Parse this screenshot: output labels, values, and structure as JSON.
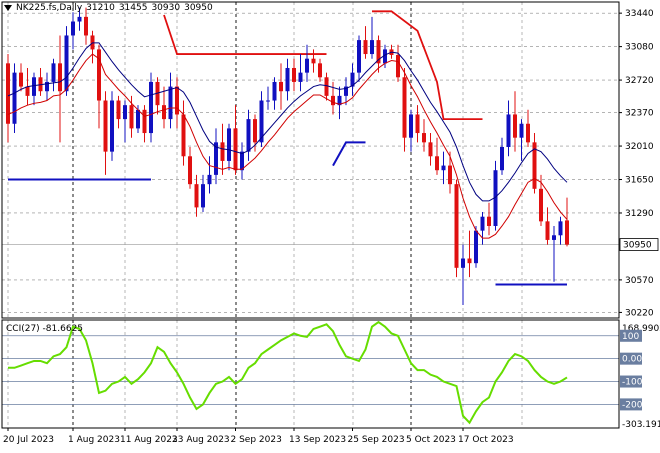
{
  "title": {
    "symbol": "NK225.fs,Daily",
    "ohlc": [
      "31210",
      "31455",
      "30930",
      "30950"
    ]
  },
  "price_axis": {
    "labels": [
      "33440",
      "33080",
      "32720",
      "32370",
      "32010",
      "31650",
      "31290",
      "30950",
      "30570",
      "30220"
    ],
    "current_price": "30950"
  },
  "cci": {
    "label": "CCI(27) -81.6625",
    "axis_labels": [
      "168.9902",
      "100",
      "0.00",
      "-100",
      "-200",
      "-303.191"
    ]
  },
  "time_axis": {
    "labels": [
      "20 Jul 2023",
      "1 Aug 2023",
      "11 Aug 2023",
      "23 Aug 2023",
      "2 Sep 2023",
      "13 Sep 2023",
      "25 Sep 2023",
      "5 Oct 2023",
      "17 Oct 2023"
    ]
  },
  "colors": {
    "bull": "#1010c0",
    "bear": "#e01010",
    "fast_ma": "#d00000",
    "slow_ma": "#000080",
    "cci_line": "#66dd00",
    "cci_level": "#6a7ea0",
    "grid": "#888888"
  },
  "chart_data": {
    "type": "candlestick",
    "price_range": [
      30160,
      33560
    ],
    "cci_range": [
      -303.191,
      168.9902
    ],
    "candles": [
      [
        32900,
        33000,
        32050,
        32250
      ],
      [
        32250,
        32900,
        32150,
        32800
      ],
      [
        32800,
        32900,
        32600,
        32650
      ],
      [
        32650,
        32850,
        32450,
        32550
      ],
      [
        32550,
        32800,
        32450,
        32750
      ],
      [
        32750,
        32850,
        32550,
        32600
      ],
      [
        32600,
        32800,
        32500,
        32700
      ],
      [
        32700,
        32950,
        32600,
        32900
      ],
      [
        32900,
        33200,
        32050,
        32600
      ],
      [
        32600,
        33300,
        32550,
        33200
      ],
      [
        33200,
        33450,
        33050,
        33350
      ],
      [
        33350,
        33500,
        33250,
        33400
      ],
      [
        33400,
        33500,
        33100,
        33200
      ],
      [
        33200,
        33250,
        32900,
        33050
      ],
      [
        33050,
        33100,
        32200,
        32500
      ],
      [
        32500,
        32600,
        31700,
        31950
      ],
      [
        31950,
        32600,
        31850,
        32500
      ],
      [
        32500,
        32550,
        32200,
        32300
      ],
      [
        32300,
        32500,
        32050,
        32450
      ],
      [
        32450,
        32550,
        32100,
        32200
      ],
      [
        32200,
        32450,
        32150,
        32400
      ],
      [
        32400,
        32450,
        32050,
        32150
      ],
      [
        32150,
        32800,
        32050,
        32700
      ],
      [
        32700,
        32750,
        32350,
        32450
      ],
      [
        32450,
        32650,
        32200,
        32300
      ],
      [
        32300,
        32800,
        32200,
        32650
      ],
      [
        32650,
        32750,
        32200,
        32350
      ],
      [
        32350,
        32500,
        31800,
        31900
      ],
      [
        31900,
        32000,
        31550,
        31600
      ],
      [
        31600,
        31700,
        31250,
        31350
      ],
      [
        31350,
        31700,
        31300,
        31600
      ],
      [
        31600,
        31900,
        31500,
        31700
      ],
      [
        31700,
        32200,
        31600,
        32050
      ],
      [
        32050,
        32250,
        31700,
        31850
      ],
      [
        31850,
        32250,
        31750,
        32200
      ],
      [
        32200,
        32450,
        31700,
        31750
      ],
      [
        31750,
        32050,
        31650,
        31950
      ],
      [
        31950,
        32400,
        31850,
        32300
      ],
      [
        32300,
        32350,
        31950,
        32050
      ],
      [
        32050,
        32600,
        32000,
        32500
      ],
      [
        32500,
        32650,
        32400,
        32500
      ],
      [
        32500,
        32750,
        32400,
        32700
      ],
      [
        32700,
        32900,
        32400,
        32600
      ],
      [
        32600,
        32950,
        32500,
        32850
      ],
      [
        32850,
        32950,
        32600,
        32700
      ],
      [
        32700,
        33000,
        32600,
        32800
      ],
      [
        32800,
        33100,
        32700,
        32950
      ],
      [
        32950,
        33050,
        32800,
        32900
      ],
      [
        32900,
        32950,
        32700,
        32750
      ],
      [
        32750,
        32800,
        32500,
        32550
      ],
      [
        32550,
        32700,
        32350,
        32450
      ],
      [
        32450,
        32650,
        32300,
        32550
      ],
      [
        32550,
        32750,
        32450,
        32650
      ],
      [
        32650,
        32900,
        32550,
        32800
      ],
      [
        32800,
        33200,
        32700,
        33150
      ],
      [
        33150,
        33300,
        32950,
        33000
      ],
      [
        33000,
        33400,
        32950,
        33150
      ],
      [
        33150,
        33200,
        32800,
        32900
      ],
      [
        32900,
        33100,
        32850,
        33050
      ],
      [
        33050,
        33100,
        32950,
        32990
      ],
      [
        32990,
        33100,
        32700,
        32750
      ],
      [
        32750,
        32850,
        31950,
        32100
      ],
      [
        32100,
        32400,
        31950,
        32350
      ],
      [
        32350,
        32450,
        32050,
        32150
      ],
      [
        32150,
        32300,
        31950,
        32050
      ],
      [
        32050,
        32150,
        31800,
        31900
      ],
      [
        31900,
        32100,
        31700,
        31750
      ],
      [
        31750,
        31950,
        31600,
        31800
      ],
      [
        31800,
        31950,
        31500,
        31600
      ],
      [
        31600,
        31650,
        30600,
        30700
      ],
      [
        30700,
        30950,
        30300,
        30800
      ],
      [
        30800,
        31100,
        30600,
        30750
      ],
      [
        30750,
        31150,
        30700,
        31100
      ],
      [
        31100,
        31300,
        30950,
        31250
      ],
      [
        31250,
        31400,
        31050,
        31150
      ],
      [
        31150,
        31850,
        31100,
        31750
      ],
      [
        31750,
        32100,
        31700,
        32000
      ],
      [
        32000,
        32500,
        31900,
        32350
      ],
      [
        32350,
        32600,
        31950,
        32100
      ],
      [
        32100,
        32300,
        31850,
        32250
      ],
      [
        32250,
        32400,
        32000,
        32050
      ],
      [
        32050,
        32150,
        31500,
        31550
      ],
      [
        31550,
        31700,
        31150,
        31200
      ],
      [
        31200,
        31350,
        30950,
        31000
      ],
      [
        31000,
        31150,
        30550,
        31050
      ],
      [
        31050,
        31250,
        30950,
        31200
      ],
      [
        31210,
        31455,
        30930,
        30950
      ]
    ],
    "fast_ma": [
      32350,
      32380,
      32420,
      32450,
      32470,
      32480,
      32500,
      32550,
      32560,
      32620,
      32720,
      32830,
      32930,
      33000,
      32950,
      32780,
      32700,
      32620,
      32550,
      32470,
      32400,
      32330,
      32350,
      32380,
      32400,
      32420,
      32420,
      32350,
      32220,
      32050,
      31900,
      31800,
      31780,
      31760,
      31780,
      31760,
      31760,
      31820,
      31880,
      31960,
      32050,
      32130,
      32220,
      32310,
      32380,
      32440,
      32500,
      32560,
      32560,
      32520,
      32480,
      32460,
      32480,
      32530,
      32620,
      32700,
      32780,
      32850,
      32900,
      32930,
      32920,
      32800,
      32660,
      32540,
      32400,
      32270,
      32150,
      32020,
      31900,
      31700,
      31450,
      31250,
      31100,
      31020,
      31020,
      31060,
      31150,
      31250,
      31380,
      31500,
      31620,
      31660,
      31620,
      31520,
      31400,
      31300,
      31220
    ],
    "slow_ma": [
      32550,
      32580,
      32620,
      32650,
      32660,
      32670,
      32680,
      32690,
      32700,
      32750,
      32850,
      32960,
      33060,
      33120,
      33120,
      33020,
      32920,
      32830,
      32750,
      32670,
      32600,
      32540,
      32560,
      32580,
      32600,
      32620,
      32640,
      32590,
      32480,
      32330,
      32180,
      32060,
      32000,
      31980,
      31970,
      31950,
      31930,
      31960,
      32020,
      32100,
      32180,
      32260,
      32340,
      32420,
      32490,
      32550,
      32600,
      32650,
      32670,
      32660,
      32640,
      32620,
      32630,
      32660,
      32720,
      32800,
      32870,
      32940,
      32990,
      33020,
      33010,
      32930,
      32820,
      32720,
      32600,
      32480,
      32380,
      32270,
      32160,
      32000,
      31800,
      31620,
      31490,
      31420,
      31420,
      31460,
      31530,
      31620,
      31720,
      31830,
      31930,
      31980,
      31950,
      31870,
      31770,
      31690,
      31620
    ],
    "cci": [
      -40,
      -40,
      -30,
      -20,
      -10,
      -10,
      -20,
      10,
      20,
      50,
      140,
      130,
      80,
      -20,
      -150,
      -140,
      -110,
      -100,
      -80,
      -110,
      -90,
      -60,
      -20,
      50,
      30,
      -20,
      -60,
      -110,
      -170,
      -220,
      -200,
      -150,
      -110,
      -100,
      -80,
      -110,
      -90,
      -40,
      -20,
      20,
      40,
      60,
      80,
      95,
      110,
      100,
      95,
      130,
      140,
      150,
      120,
      60,
      10,
      0,
      -10,
      40,
      140,
      160,
      140,
      110,
      100,
      40,
      -20,
      -50,
      -50,
      -70,
      -80,
      -100,
      -110,
      -120,
      -250,
      -280,
      -230,
      -190,
      -170,
      -100,
      -60,
      -10,
      20,
      10,
      -10,
      -50,
      -80,
      -100,
      -110,
      -100,
      -82
    ]
  }
}
